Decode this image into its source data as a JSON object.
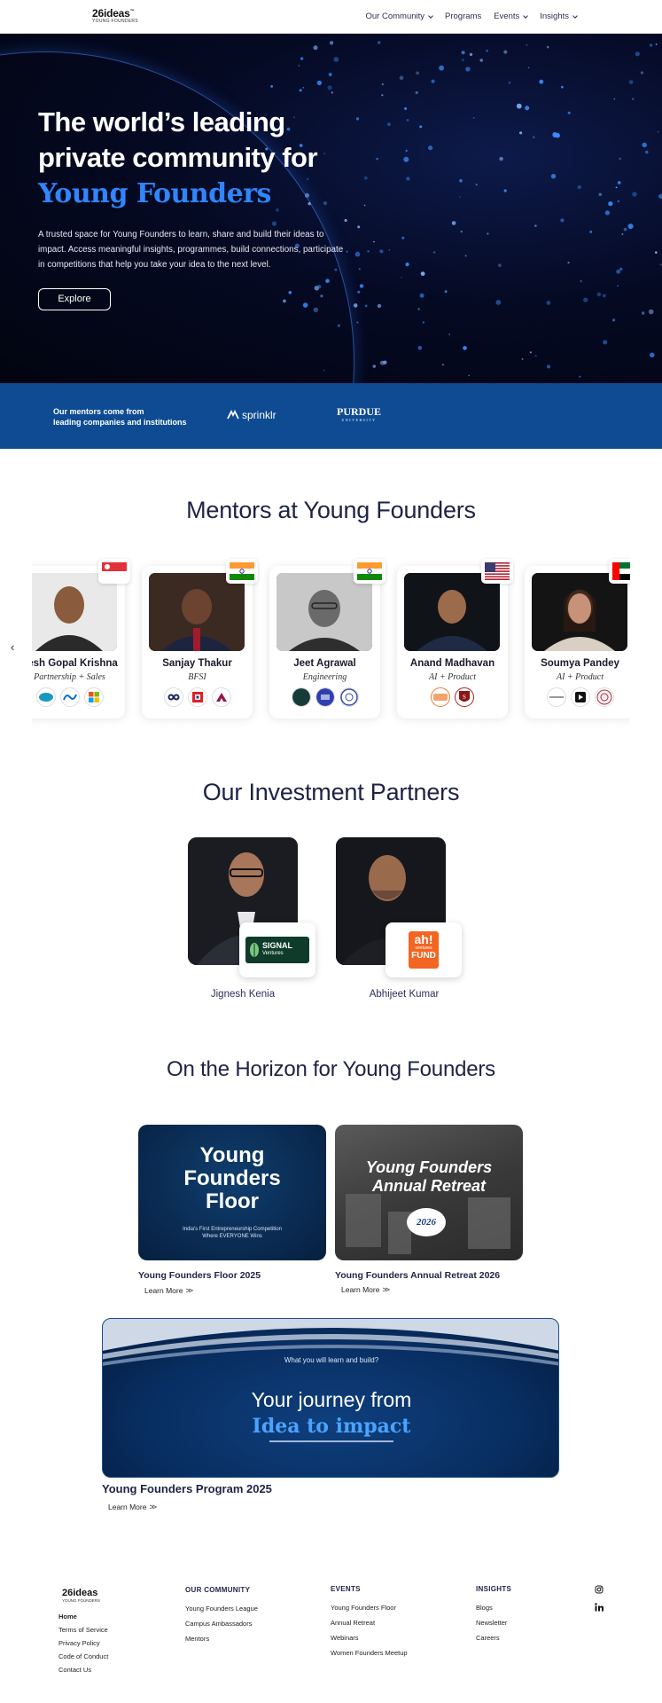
{
  "nav": {
    "logo": "26ideas",
    "logo_tm": "™",
    "logo_sub": "YOUNG FOUNDERS",
    "links": [
      {
        "label": "Our Community",
        "dropdown": true
      },
      {
        "label": "Programs",
        "dropdown": false
      },
      {
        "label": "Events",
        "dropdown": true
      },
      {
        "label": "Insights",
        "dropdown": true
      }
    ]
  },
  "hero": {
    "title_line1": "The world’s leading",
    "title_line2": "private community for",
    "title_accent": "Young Founders",
    "description": "A trusted space for Young Founders to learn, share and build their ideas to impact. Access meaningful insights, programmes, build connections, participate in competitions that help you take your idea to the next level.",
    "cta": "Explore"
  },
  "strip": {
    "text_line1": "Our mentors come from",
    "text_line2": "leading companies and institutions",
    "logo1": "sprinklr",
    "logo2": "PURDUE",
    "logo2_sub": "UNIVERSITY"
  },
  "mentors": {
    "heading": "Mentors at Young Founders",
    "prev_icon": "‹",
    "cards": [
      {
        "name": "nesh Gopal Krishna",
        "role": "Partnership + Sales",
        "flag": "singapore",
        "logos": [
          "salesforce",
          "meta",
          "microsoft"
        ]
      },
      {
        "name": "Sanjay Thakur",
        "role": "BFSI",
        "flag": "india",
        "logos": [
          "icici",
          "hdfc",
          "axis"
        ]
      },
      {
        "name": "Jeet Agrawal",
        "role": "Engineering",
        "flag": "india",
        "logos": [
          "startup",
          "institute",
          "university"
        ]
      },
      {
        "name": "Anand Madhavan",
        "role": "AI + Product",
        "flag": "usa",
        "logos": [
          "company",
          "stanford"
        ]
      },
      {
        "name": "Soumya Pandey",
        "role": "AI + Product",
        "flag": "uae",
        "logos": [
          "company",
          "brand",
          "university"
        ]
      }
    ]
  },
  "partners": {
    "heading": "Our Investment Partners",
    "items": [
      {
        "name": "Jignesh Kenia",
        "badge": "SIGNAL",
        "badge_sub": "Ventures"
      },
      {
        "name": "Abhijeet Kumar",
        "badge": "ah!",
        "badge_sub": "ventures",
        "badge_extra": "FUND"
      }
    ]
  },
  "horizon": {
    "heading": "On the Horizon for Young Founders",
    "events": [
      {
        "title": "Young Founders Floor 2025",
        "learn": "Learn More",
        "img_line1": "Young",
        "img_line2": "Founders",
        "img_line3": "Floor",
        "img_caption1": "India's First Entrepreneurship Competition",
        "img_caption2": "Where EVERYONE Wins"
      },
      {
        "title": "Young Founders Annual Retreat 2026",
        "learn": "Learn More",
        "img_line1": "Young Founders",
        "img_line2": "Annual Retreat",
        "img_badge": "2026"
      }
    ],
    "program": {
      "title": "Young Founders Program 2025",
      "learn": "Learn More",
      "kicker": "What you will learn and build?",
      "line1": "Your journey from",
      "line2": "Idea to impact"
    }
  },
  "footer": {
    "logo": "26ideas",
    "logo_sub": "YOUNG FOUNDERS",
    "left_links": [
      "Home",
      "Terms of Service",
      "Privacy Policy",
      "Code of Conduct",
      "Contact Us"
    ],
    "community": {
      "head": "OUR COMMUNITY",
      "items": [
        "Young Founders League",
        "Campus Ambassadors",
        "Mentors"
      ]
    },
    "events": {
      "head": "EVENTS",
      "items": [
        "Young Founders Floor",
        "Annual Retreat",
        "Webinars",
        "Women Founders Meetup"
      ]
    },
    "insights": {
      "head": "INSIGHTS",
      "items": [
        "Blogs",
        "Newsletter",
        "Careers"
      ]
    },
    "social": [
      "instagram-icon",
      "linkedin-icon"
    ]
  },
  "colors": {
    "accent": "#2f86ff",
    "strip": "#0e4b93",
    "navy": "#1e2346"
  }
}
